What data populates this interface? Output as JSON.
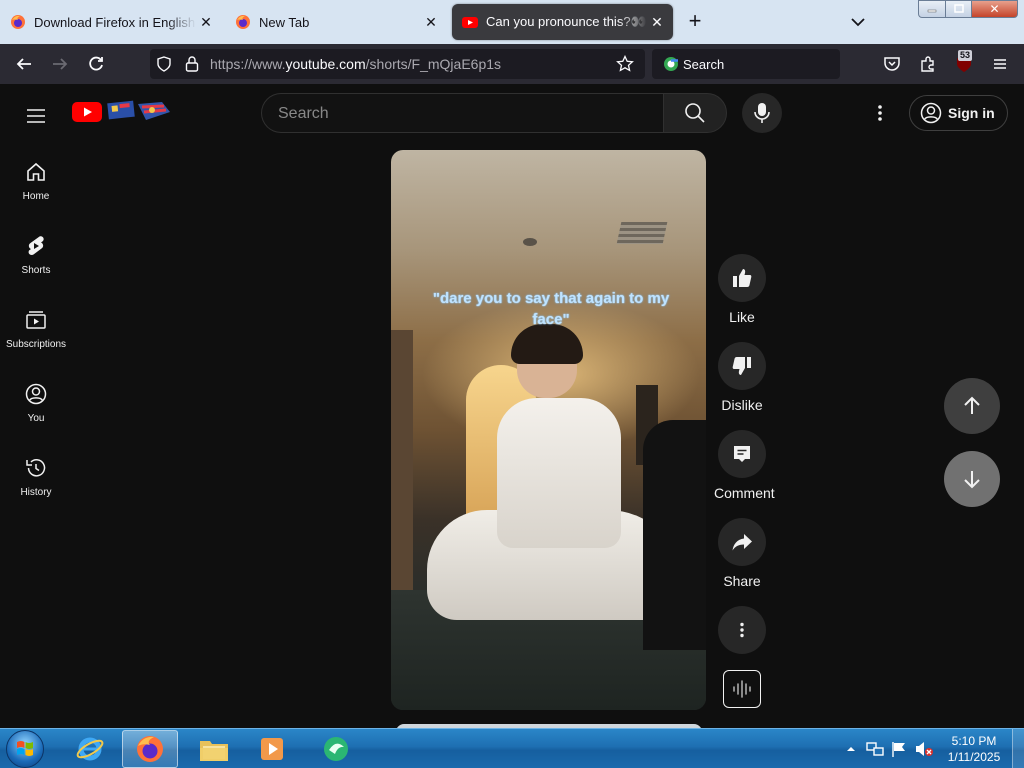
{
  "browser": {
    "tabs": [
      {
        "title": "Download Firefox in English (U",
        "active": false
      },
      {
        "title": "New Tab",
        "active": false
      },
      {
        "title": "Can you pronounce this?👀 Th",
        "active": true
      }
    ],
    "url": {
      "prefix": "https://www.",
      "host": "youtube.com",
      "path": "/shorts/F_mQjaE6p1s"
    },
    "search_label": "Search",
    "extension_badge": "53",
    "close_glyph": "✕",
    "newtab_glyph": "+"
  },
  "youtube": {
    "search_placeholder": "Search",
    "signin_label": "Sign in",
    "guide": [
      {
        "label": "Home",
        "icon": "home-icon"
      },
      {
        "label": "Shorts",
        "icon": "shorts-icon"
      },
      {
        "label": "Subscriptions",
        "icon": "subscriptions-icon"
      },
      {
        "label": "You",
        "icon": "you-icon"
      },
      {
        "label": "History",
        "icon": "history-icon"
      }
    ],
    "video_caption": "\"dare you to say that again to my face\"",
    "actions": [
      {
        "label": "Like",
        "icon": "thumbs-up-icon"
      },
      {
        "label": "Dislike",
        "icon": "thumbs-down-icon"
      },
      {
        "label": "Comment",
        "icon": "comment-icon"
      },
      {
        "label": "Share",
        "icon": "share-icon"
      }
    ]
  },
  "taskbar": {
    "time": "5:10 PM",
    "date": "1/11/2025",
    "pinned": [
      "internet-explorer-icon",
      "firefox-icon",
      "file-explorer-icon",
      "media-player-icon",
      "app-icon"
    ]
  },
  "colors": {
    "yt_red": "#ff0000",
    "yt_bg": "#0f0f0f",
    "firefox_toolbar": "#2b2a33",
    "tabstrip": "#d7e4f2"
  }
}
